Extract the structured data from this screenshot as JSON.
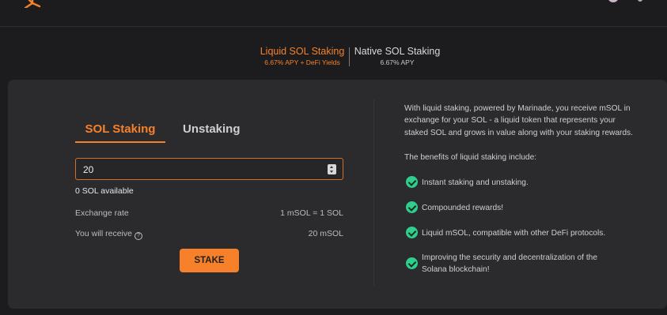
{
  "mode_switch": {
    "liquid": {
      "name": "Liquid SOL Staking",
      "sub": "6.67% APY + DeFi Yields"
    },
    "native": {
      "name": "Native SOL Staking",
      "sub": "6.67% APY"
    }
  },
  "tabs": {
    "staking": "SOL Staking",
    "unstaking": "Unstaking"
  },
  "amount": {
    "value": "20"
  },
  "available": "0 SOL available",
  "exchange_rate": {
    "label": "Exchange rate",
    "value": "1 mSOL = 1 SOL"
  },
  "receive": {
    "label": "You will receive",
    "value": "20 mSOL"
  },
  "stake_button": "STAKE",
  "info": {
    "description": "With liquid staking, powered by Marinade, you receive mSOL in exchange for your SOL - a liquid token that represents your staked SOL and grows in value along with your staking rewards.",
    "benefits_title": "The benefits of liquid staking include:",
    "benefits": [
      "Instant staking and unstaking.",
      "Compounded rewards!",
      "Liquid mSOL, compatible with other DeFi protocols.",
      "Improving the security and decentralization of the Solana blockchain!"
    ]
  },
  "colors": {
    "accent": "#f6812a",
    "check": "#2ecf8c",
    "panel": "#2b2b2d",
    "background": "#1c1c1e"
  },
  "icons": [
    "logo-icon",
    "stepper-icon",
    "help-icon",
    "check-icon"
  ]
}
